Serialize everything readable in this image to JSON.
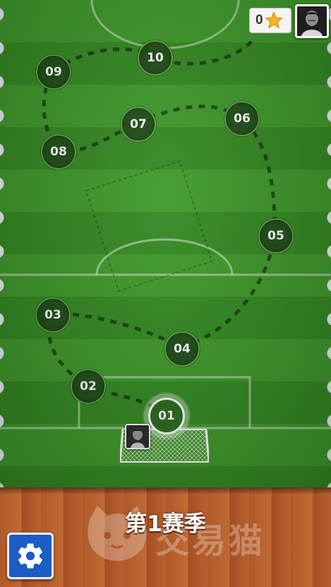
{
  "header": {
    "star_count": "0",
    "star_icon": "star-icon",
    "avatar_icon": "player-avatar"
  },
  "levels": [
    {
      "label": "01",
      "current": true
    },
    {
      "label": "02",
      "current": false
    },
    {
      "label": "03",
      "current": false
    },
    {
      "label": "04",
      "current": false
    },
    {
      "label": "05",
      "current": false
    },
    {
      "label": "06",
      "current": false
    },
    {
      "label": "07",
      "current": false
    },
    {
      "label": "08",
      "current": false
    },
    {
      "label": "09",
      "current": false
    },
    {
      "label": "10",
      "current": false
    }
  ],
  "season": {
    "title": "第1赛季"
  },
  "watermark": {
    "text": "交易猫"
  },
  "footer": {
    "settings_icon": "gear-icon"
  },
  "colors": {
    "pitch_light": "#3f9a2a",
    "pitch_dark": "#348a22",
    "node_fill": "#1f4e17",
    "floor": "#b05a2a",
    "settings_bg": "#1c5cc4",
    "star": "#f7b51c"
  }
}
